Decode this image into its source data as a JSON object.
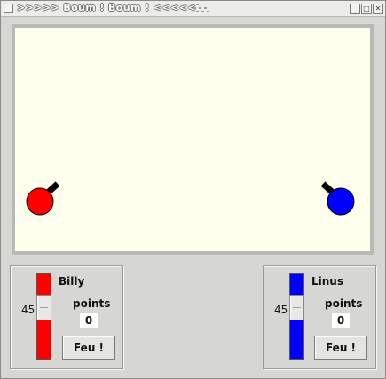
{
  "window": {
    "title": ">>>>> Boum ! Boum ! <<<<<"
  },
  "controls": {
    "minimize": "_",
    "maximize": "□",
    "close": "✕"
  },
  "players": [
    {
      "name": "Billy",
      "color": "#ff0000",
      "angle": "45",
      "points_label": "points",
      "score": "0",
      "fire_label": "Feu !"
    },
    {
      "name": "Linus",
      "color": "#0000ff",
      "angle": "45",
      "points_label": "points",
      "score": "0",
      "fire_label": "Feu !"
    }
  ],
  "canvas": {
    "background": "#fefeec"
  }
}
